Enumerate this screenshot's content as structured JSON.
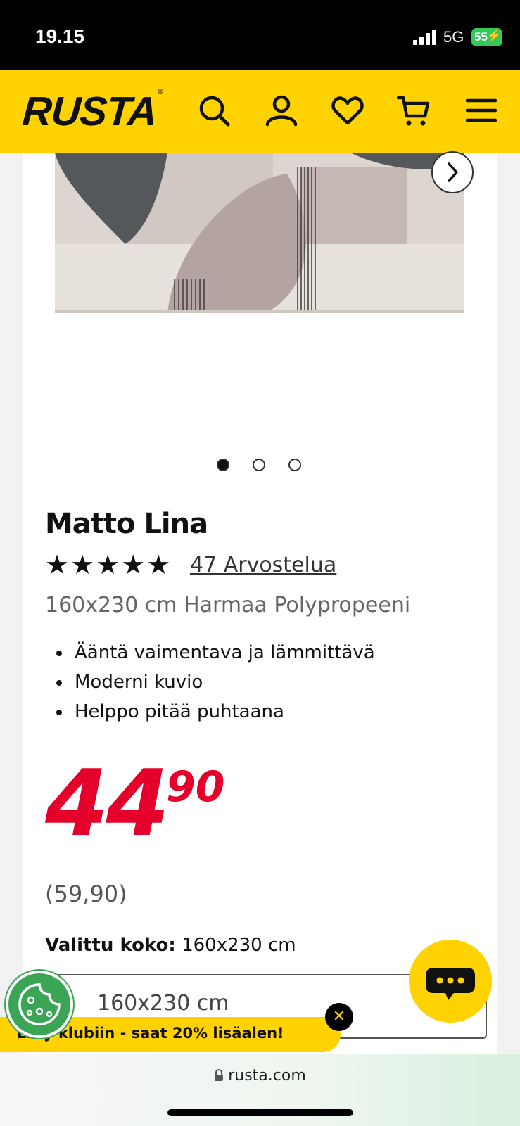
{
  "status_bar": {
    "time": "19.15",
    "network": "5G",
    "battery": "55"
  },
  "header": {
    "logo": "RUSTA",
    "icons": [
      "search-icon",
      "account-icon",
      "heart-icon",
      "cart-icon",
      "menu-icon"
    ],
    "colors": {
      "brand_yellow": "#ffd200",
      "price_red": "#e4002b"
    }
  },
  "gallery": {
    "dot_count": 3,
    "active_dot": 1
  },
  "product": {
    "title": "Matto Lina",
    "rating_stars": "★★★★★",
    "rating_value": 5,
    "reviews": "47 Arvostelua",
    "subtitle": "160x230 cm Harmaa Polypropeeni",
    "features": [
      "Ääntä vaimentava ja lämmittävä",
      "Moderni kuvio",
      "Helppo pitää puhtaana"
    ],
    "price_integer": "44",
    "price_decimals": "90",
    "old_price": "(59,90)",
    "size_label": "Valittu koko:",
    "size_value": "160x230 cm",
    "size_select_value": "160x230 cm"
  },
  "club_banner": {
    "text": "Liity klubiin - saat 20% lisäalen!",
    "close": "✕"
  },
  "browser": {
    "url": "rusta.com"
  }
}
